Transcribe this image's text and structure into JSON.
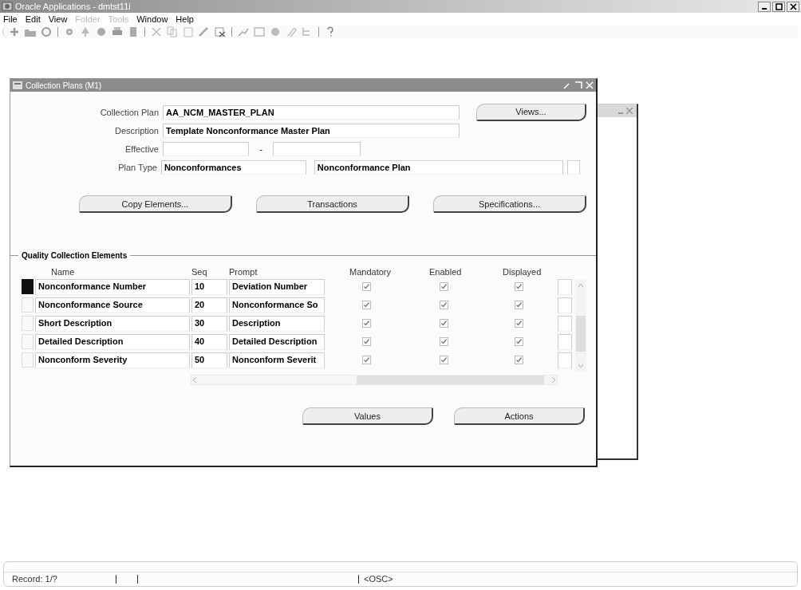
{
  "window": {
    "title": "Oracle Applications - dmtst11i"
  },
  "menu": [
    {
      "label": "File",
      "disabled": false
    },
    {
      "label": "Edit",
      "disabled": false
    },
    {
      "label": "View",
      "disabled": false
    },
    {
      "label": "Folder",
      "disabled": true
    },
    {
      "label": "Tools",
      "disabled": true
    },
    {
      "label": "Window",
      "disabled": false
    },
    {
      "label": "Help",
      "disabled": false
    }
  ],
  "form": {
    "title": "Collection Plans (M1)",
    "collection_plan": {
      "label": "Collection Plan",
      "value": "AA_NCM_MASTER_PLAN"
    },
    "description": {
      "label": "Description",
      "value": "Template Nonconformance Master Plan"
    },
    "effective": {
      "label": "Effective",
      "separator": "-"
    },
    "plan_type": {
      "label": "Plan Type",
      "value": "Nonconformances",
      "description": "Nonconformance Plan"
    },
    "views_button": "Views...",
    "buttons": [
      "Copy Elements...",
      "Transactions",
      "Specifications..."
    ],
    "elements": {
      "title": "Quality Collection Elements",
      "columns": [
        "Name",
        "Seq",
        "Prompt",
        "Mandatory",
        "Enabled",
        "Displayed"
      ],
      "rows": [
        {
          "selected": true,
          "name": "Nonconformance Number",
          "seq": "10",
          "prompt": "Deviation Number",
          "mandatory": true,
          "enabled": true,
          "displayed": true
        },
        {
          "selected": false,
          "name": "Nonconformance Source",
          "seq": "20",
          "prompt": "Nonconformance So",
          "mandatory": true,
          "enabled": true,
          "displayed": true
        },
        {
          "selected": false,
          "name": "Short Description",
          "seq": "30",
          "prompt": "Description",
          "mandatory": true,
          "enabled": true,
          "displayed": true
        },
        {
          "selected": false,
          "name": "Detailed Description",
          "seq": "40",
          "prompt": "Detailed Description",
          "mandatory": true,
          "enabled": true,
          "displayed": true
        },
        {
          "selected": false,
          "name": "Nonconform Severity",
          "seq": "50",
          "prompt": "Nonconform Severit",
          "mandatory": true,
          "enabled": true,
          "displayed": true
        }
      ]
    },
    "bottom_buttons": [
      "Values",
      "Actions"
    ]
  },
  "status_bar": {
    "record": "Record: 1/?",
    "mode": "<OSC>"
  }
}
